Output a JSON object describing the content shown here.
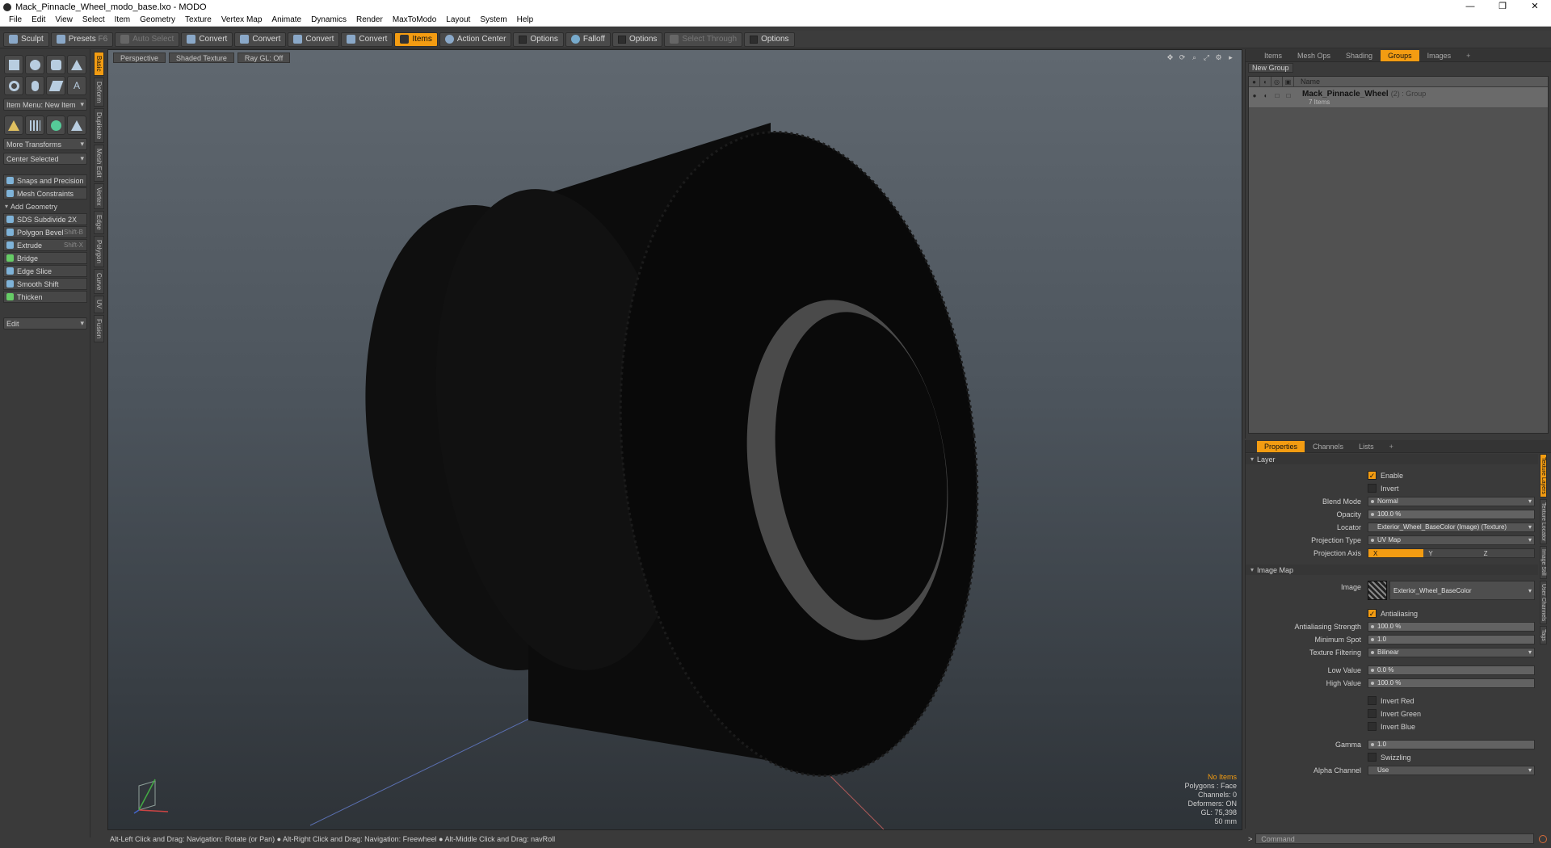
{
  "window": {
    "title": "Mack_Pinnacle_Wheel_modo_base.lxo - MODO",
    "controls": [
      "—",
      "❐",
      "✕"
    ]
  },
  "menu": [
    "File",
    "Edit",
    "View",
    "Select",
    "Item",
    "Geometry",
    "Texture",
    "Vertex Map",
    "Animate",
    "Dynamics",
    "Render",
    "MaxToModo",
    "Layout",
    "System",
    "Help"
  ],
  "toolbar": {
    "sculpt": "Sculpt",
    "presets": "Presets",
    "presets_key": "F6",
    "auto_select": "Auto Select",
    "convert1": "Convert",
    "convert2": "Convert",
    "convert3": "Convert",
    "convert4": "Convert",
    "items": "Items",
    "action_center": "Action Center",
    "options1": "Options",
    "falloff": "Falloff",
    "options2": "Options",
    "select_through": "Select Through",
    "options3": "Options"
  },
  "left": {
    "item_menu": "Item Menu: New Item",
    "more_transforms": "More Transforms",
    "center_selected": "Center Selected",
    "snaps": "Snaps and Precision",
    "mesh_constraints": "Mesh Constraints",
    "add_geometry": "Add Geometry",
    "tools": [
      {
        "label": "SDS Subdivide 2X",
        "key": ""
      },
      {
        "label": "Polygon Bevel",
        "key": "Shift-B"
      },
      {
        "label": "Extrude",
        "key": "Shift-X"
      },
      {
        "label": "Bridge",
        "key": ""
      },
      {
        "label": "Edge Slice",
        "key": ""
      },
      {
        "label": "Smooth Shift",
        "key": ""
      },
      {
        "label": "Thicken",
        "key": ""
      }
    ],
    "edit": "Edit",
    "vtabs": [
      "Basic",
      "Deform",
      "Duplicate",
      "Mesh Edit",
      "Vertex",
      "Edge",
      "Polygon",
      "Curve",
      "UV",
      "Fusion"
    ]
  },
  "viewport": {
    "perspective": "Perspective",
    "shaded_texture": "Shaded Texture",
    "ray_gl": "Ray GL: Off",
    "stats": {
      "no_items": "No Items",
      "polygons": "Polygons : Face",
      "channels": "Channels: 0",
      "deformers": "Deformers: ON",
      "gl": "GL: 75,398",
      "lens": "50 mm"
    }
  },
  "status": "Alt-Left Click and Drag: Navigation: Rotate (or Pan) ● Alt-Right Click and Drag: Navigation: Freewheel ● Alt-Middle Click and Drag: navRoll",
  "right_top": {
    "tabs": [
      "Items",
      "Mesh Ops",
      "Shading",
      "Groups",
      "Images",
      "+"
    ],
    "new_group": "New Group",
    "col_name": "Name",
    "group_name": "Mack_Pinnacle_Wheel",
    "group_meta": "(2) : Group",
    "group_sub": "7 Items"
  },
  "right_bottom": {
    "tabs": [
      "Properties",
      "Channels",
      "Lists",
      "+"
    ],
    "layer": "Layer",
    "enable": "Enable",
    "invert": "Invert",
    "blend_mode_label": "Blend Mode",
    "blend_mode": "Normal",
    "opacity_label": "Opacity",
    "opacity": "100.0 %",
    "locator_label": "Locator",
    "locator": "Exterior_Wheel_BaseColor (Image) (Texture)",
    "projection_type_label": "Projection Type",
    "projection_type": "UV Map",
    "projection_axis_label": "Projection Axis",
    "axis_x": "X",
    "axis_y": "Y",
    "axis_z": "Z",
    "image_map": "Image Map",
    "image_label": "Image",
    "image": "Exterior_Wheel_BaseColor",
    "antialiasing": "Antialiasing",
    "aa_strength_label": "Antialiasing Strength",
    "aa_strength": "100.0 %",
    "min_spot_label": "Minimum Spot",
    "min_spot": "1.0",
    "tex_filter_label": "Texture Filtering",
    "tex_filter": "Bilinear",
    "low_value_label": "Low Value",
    "low_value": "0.0 %",
    "high_value_label": "High Value",
    "high_value": "100.0 %",
    "invert_red": "Invert Red",
    "invert_green": "Invert Green",
    "invert_blue": "Invert Blue",
    "gamma_label": "Gamma",
    "gamma": "1.0",
    "swizzling": "Swizzling",
    "alpha_channel_label": "Alpha Channel",
    "alpha_channel": "Use",
    "vtabs": [
      "Texture Layers",
      "Texture Locator",
      "Image Still",
      "User Channels",
      "Tags"
    ]
  },
  "command": {
    "placeholder": "Command"
  }
}
